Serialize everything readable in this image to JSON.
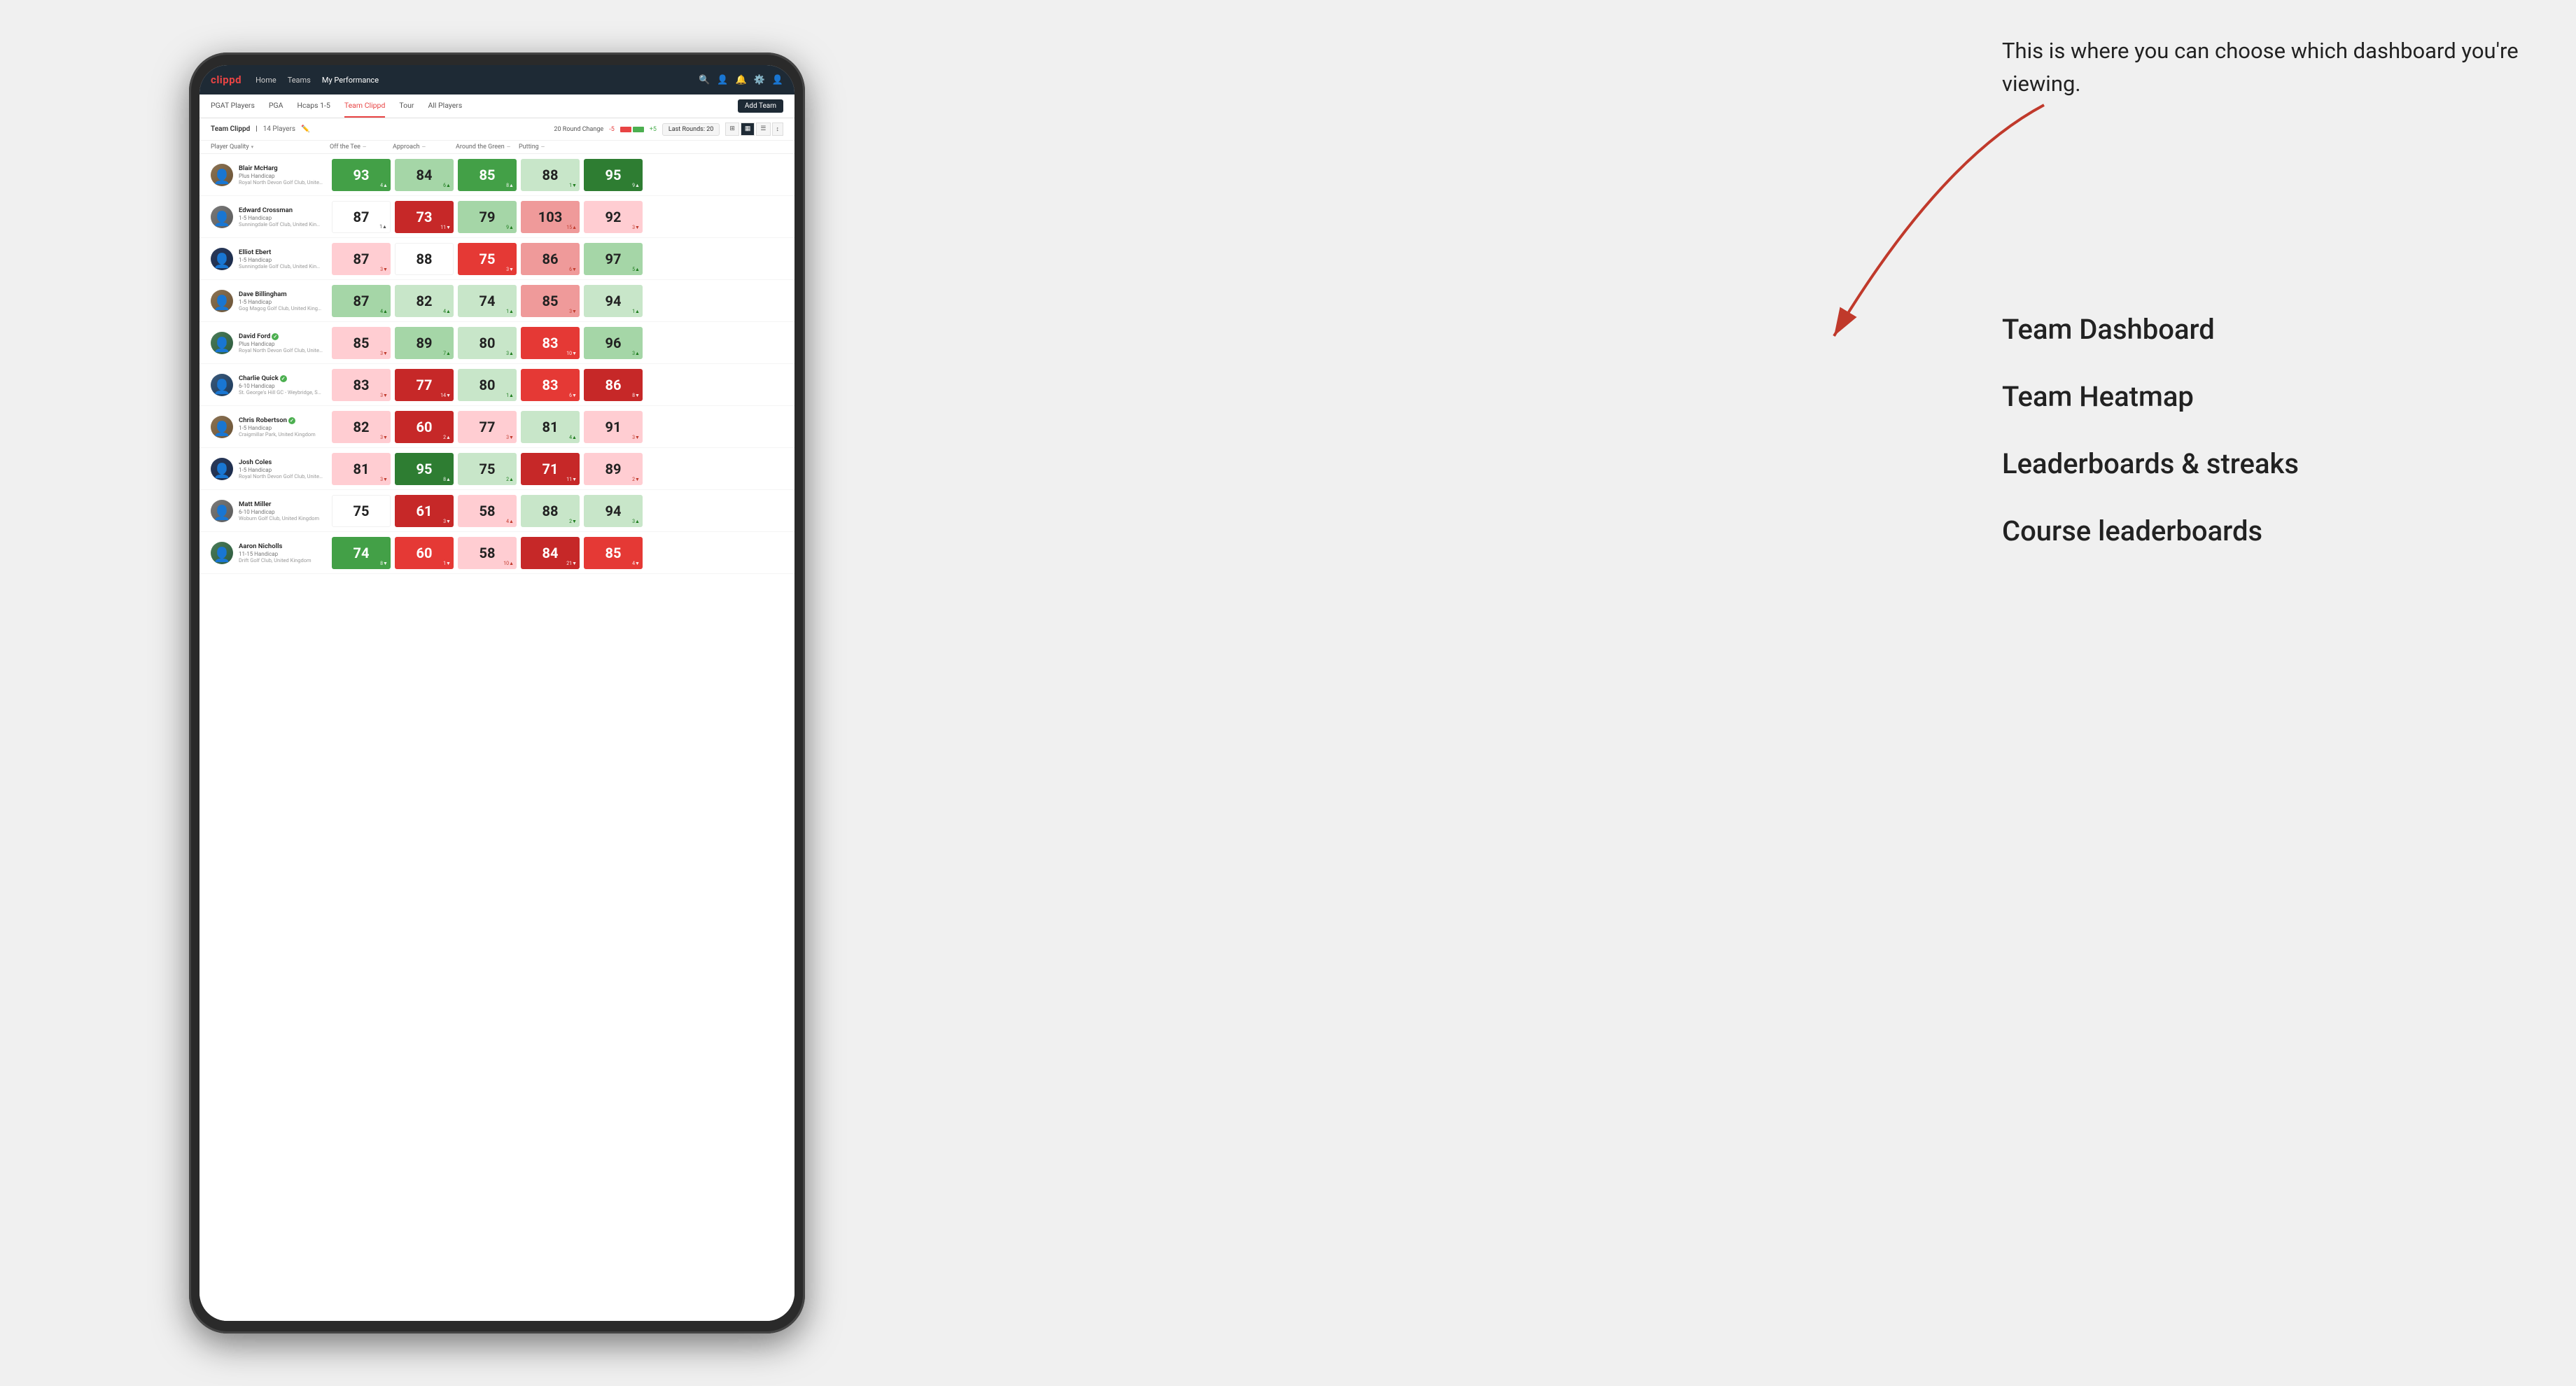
{
  "annotation": {
    "text": "This is where you can choose which dashboard you're viewing.",
    "dashboard_options": [
      "Team Dashboard",
      "Team Heatmap",
      "Leaderboards & streaks",
      "Course leaderboards"
    ]
  },
  "nav": {
    "logo": "clippd",
    "links": [
      "Home",
      "Teams",
      "My Performance"
    ],
    "active_link": "My Performance"
  },
  "sub_nav": {
    "links": [
      "PGAT Players",
      "PGA",
      "Hcaps 1-5",
      "Team Clippd",
      "Tour",
      "All Players"
    ],
    "active_link": "Team Clippd",
    "add_team_label": "Add Team"
  },
  "team_header": {
    "team_name": "Team Clippd",
    "separator": "|",
    "count_label": "14 Players",
    "round_change_label": "20 Round Change",
    "change_neg": "-5",
    "change_pos": "+5",
    "last_rounds_label": "Last Rounds:",
    "last_rounds_value": "20"
  },
  "columns": {
    "player_quality": "Player Quality",
    "off_tee": "Off the Tee",
    "approach": "Approach",
    "around_green": "Around the Green",
    "putting": "Putting"
  },
  "players": [
    {
      "name": "Blair McHarg",
      "handicap": "Plus Handicap",
      "club": "Royal North Devon Golf Club, United Kingdom",
      "avatar_color": "brown",
      "scores": {
        "player_quality": {
          "value": 93,
          "change": "+4",
          "dir": "up",
          "bg": "bg-green-mid"
        },
        "off_tee": {
          "value": 84,
          "change": "+6",
          "dir": "up",
          "bg": "bg-green-light"
        },
        "approach": {
          "value": 85,
          "change": "+8",
          "dir": "up",
          "bg": "bg-green-mid"
        },
        "around_green": {
          "value": 88,
          "change": "-1",
          "dir": "down",
          "bg": "bg-green-pale"
        },
        "putting": {
          "value": 95,
          "change": "+9",
          "dir": "up",
          "bg": "bg-green-dark"
        }
      }
    },
    {
      "name": "Edward Crossman",
      "handicap": "1-5 Handicap",
      "club": "Sunningdale Golf Club, United Kingdom",
      "avatar_color": "gray",
      "scores": {
        "player_quality": {
          "value": 87,
          "change": "+1",
          "dir": "up",
          "bg": "bg-white"
        },
        "off_tee": {
          "value": 73,
          "change": "-11",
          "dir": "down",
          "bg": "bg-red-dark"
        },
        "approach": {
          "value": 79,
          "change": "+9",
          "dir": "up",
          "bg": "bg-green-light"
        },
        "around_green": {
          "value": 103,
          "change": "+15",
          "dir": "up",
          "bg": "bg-red-light"
        },
        "putting": {
          "value": 92,
          "change": "-3",
          "dir": "down",
          "bg": "bg-red-pale"
        }
      }
    },
    {
      "name": "Elliot Ebert",
      "handicap": "1-5 Handicap",
      "club": "Sunningdale Golf Club, United Kingdom",
      "avatar_color": "darkblue",
      "scores": {
        "player_quality": {
          "value": 87,
          "change": "-3",
          "dir": "down",
          "bg": "bg-red-pale"
        },
        "off_tee": {
          "value": 88,
          "change": "",
          "dir": "none",
          "bg": "bg-white"
        },
        "approach": {
          "value": 75,
          "change": "-3",
          "dir": "down",
          "bg": "bg-red-mid"
        },
        "around_green": {
          "value": 86,
          "change": "-6",
          "dir": "down",
          "bg": "bg-red-light"
        },
        "putting": {
          "value": 97,
          "change": "+5",
          "dir": "up",
          "bg": "bg-green-light"
        }
      }
    },
    {
      "name": "Dave Billingham",
      "handicap": "1-5 Handicap",
      "club": "Gog Magog Golf Club, United Kingdom",
      "avatar_color": "brown",
      "scores": {
        "player_quality": {
          "value": 87,
          "change": "+4",
          "dir": "up",
          "bg": "bg-green-light"
        },
        "off_tee": {
          "value": 82,
          "change": "+4",
          "dir": "up",
          "bg": "bg-green-pale"
        },
        "approach": {
          "value": 74,
          "change": "+1",
          "dir": "up",
          "bg": "bg-green-pale"
        },
        "around_green": {
          "value": 85,
          "change": "-3",
          "dir": "down",
          "bg": "bg-red-light"
        },
        "putting": {
          "value": 94,
          "change": "+1",
          "dir": "up",
          "bg": "bg-green-pale"
        }
      }
    },
    {
      "name": "David Ford",
      "handicap": "Plus Handicap",
      "club": "Royal North Devon Golf Club, United Kingdom",
      "avatar_color": "green",
      "verified": true,
      "scores": {
        "player_quality": {
          "value": 85,
          "change": "-3",
          "dir": "down",
          "bg": "bg-red-pale"
        },
        "off_tee": {
          "value": 89,
          "change": "+7",
          "dir": "up",
          "bg": "bg-green-light"
        },
        "approach": {
          "value": 80,
          "change": "+3",
          "dir": "up",
          "bg": "bg-green-pale"
        },
        "around_green": {
          "value": 83,
          "change": "-10",
          "dir": "down",
          "bg": "bg-red-mid"
        },
        "putting": {
          "value": 96,
          "change": "+3",
          "dir": "up",
          "bg": "bg-green-light"
        }
      }
    },
    {
      "name": "Charlie Quick",
      "handicap": "6-10 Handicap",
      "club": "St. George's Hill GC - Weybridge, Surrey, Uni...",
      "avatar_color": "blue",
      "verified": true,
      "scores": {
        "player_quality": {
          "value": 83,
          "change": "-3",
          "dir": "down",
          "bg": "bg-red-pale"
        },
        "off_tee": {
          "value": 77,
          "change": "-14",
          "dir": "down",
          "bg": "bg-red-dark"
        },
        "approach": {
          "value": 80,
          "change": "+1",
          "dir": "up",
          "bg": "bg-green-pale"
        },
        "around_green": {
          "value": 83,
          "change": "-6",
          "dir": "down",
          "bg": "bg-red-mid"
        },
        "putting": {
          "value": 86,
          "change": "-8",
          "dir": "down",
          "bg": "bg-red-dark"
        }
      }
    },
    {
      "name": "Chris Robertson",
      "handicap": "1-5 Handicap",
      "club": "Craigmillar Park, United Kingdom",
      "avatar_color": "brown",
      "verified": true,
      "scores": {
        "player_quality": {
          "value": 82,
          "change": "-3",
          "dir": "down",
          "bg": "bg-red-pale"
        },
        "off_tee": {
          "value": 60,
          "change": "+2",
          "dir": "up",
          "bg": "bg-red-dark"
        },
        "approach": {
          "value": 77,
          "change": "-3",
          "dir": "down",
          "bg": "bg-red-pale"
        },
        "around_green": {
          "value": 81,
          "change": "+4",
          "dir": "up",
          "bg": "bg-green-pale"
        },
        "putting": {
          "value": 91,
          "change": "-3",
          "dir": "down",
          "bg": "bg-red-pale"
        }
      }
    },
    {
      "name": "Josh Coles",
      "handicap": "1-5 Handicap",
      "club": "Royal North Devon Golf Club, United Kingdom",
      "avatar_color": "darkblue",
      "scores": {
        "player_quality": {
          "value": 81,
          "change": "-3",
          "dir": "down",
          "bg": "bg-red-pale"
        },
        "off_tee": {
          "value": 95,
          "change": "+8",
          "dir": "up",
          "bg": "bg-green-dark"
        },
        "approach": {
          "value": 75,
          "change": "+2",
          "dir": "up",
          "bg": "bg-green-pale"
        },
        "around_green": {
          "value": 71,
          "change": "-11",
          "dir": "down",
          "bg": "bg-red-dark"
        },
        "putting": {
          "value": 89,
          "change": "-2",
          "dir": "down",
          "bg": "bg-red-pale"
        }
      }
    },
    {
      "name": "Matt Miller",
      "handicap": "6-10 Handicap",
      "club": "Woburn Golf Club, United Kingdom",
      "avatar_color": "gray",
      "scores": {
        "player_quality": {
          "value": 75,
          "change": "",
          "dir": "none",
          "bg": "bg-white"
        },
        "off_tee": {
          "value": 61,
          "change": "-3",
          "dir": "down",
          "bg": "bg-red-dark"
        },
        "approach": {
          "value": 58,
          "change": "+4",
          "dir": "up",
          "bg": "bg-red-pale"
        },
        "around_green": {
          "value": 88,
          "change": "-2",
          "dir": "down",
          "bg": "bg-green-pale"
        },
        "putting": {
          "value": 94,
          "change": "+3",
          "dir": "up",
          "bg": "bg-green-pale"
        }
      }
    },
    {
      "name": "Aaron Nicholls",
      "handicap": "11-15 Handicap",
      "club": "Drift Golf Club, United Kingdom",
      "avatar_color": "green",
      "scores": {
        "player_quality": {
          "value": 74,
          "change": "-8",
          "dir": "down",
          "bg": "bg-green-mid"
        },
        "off_tee": {
          "value": 60,
          "change": "-1",
          "dir": "down",
          "bg": "bg-red-mid"
        },
        "approach": {
          "value": 58,
          "change": "+10",
          "dir": "up",
          "bg": "bg-red-pale"
        },
        "around_green": {
          "value": 84,
          "change": "-21",
          "dir": "down",
          "bg": "bg-red-dark"
        },
        "putting": {
          "value": 85,
          "change": "-4",
          "dir": "down",
          "bg": "bg-red-mid"
        }
      }
    }
  ]
}
